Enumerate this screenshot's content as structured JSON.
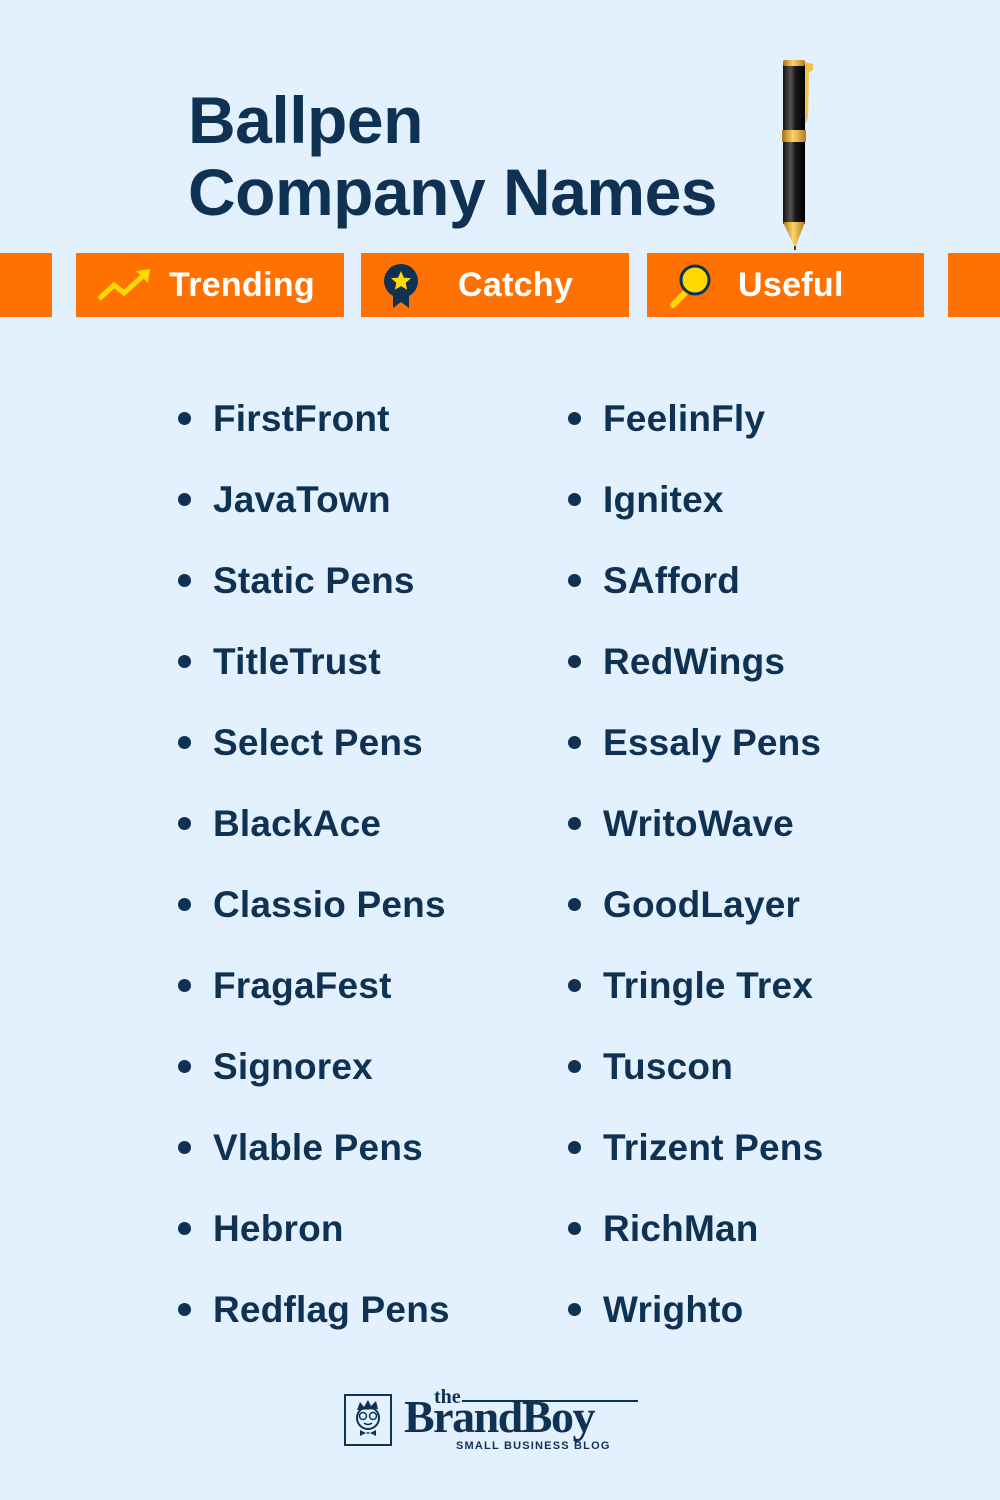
{
  "header": {
    "title_line1": "Ballpen",
    "title_line2": "Company Names",
    "pen_icon": "ballpoint-pen-icon"
  },
  "tags": [
    {
      "label": "Trending",
      "icon": "trending-up-arrow-icon"
    },
    {
      "label": "Catchy",
      "icon": "award-ribbon-star-icon"
    },
    {
      "label": "Useful",
      "icon": "magnifying-glass-icon"
    }
  ],
  "colors": {
    "background": "#e3f0fe",
    "accent_orange": "#ff7100",
    "text_navy": "#0f3253",
    "icon_yellow": "#ffd900"
  },
  "names_left": [
    "FirstFront",
    "JavaTown",
    "Static Pens",
    "TitleTrust",
    "Select Pens",
    "BlackAce",
    "Classio Pens",
    "FragaFest",
    "Signorex",
    "Vlable Pens",
    "Hebron",
    "Redflag Pens"
  ],
  "names_right": [
    "FeelinFly",
    "Ignitex",
    "SAfford",
    "RedWings",
    "Essaly Pens",
    "WritoWave",
    "GoodLayer",
    "Tringle Trex",
    "Tuscon",
    "Trizent Pens",
    "RichMan",
    "Wrighto"
  ],
  "footer": {
    "logo_the": "the",
    "logo_brand": "BrandBoy",
    "logo_tagline": "SMALL BUSINESS BLOG",
    "logo_icon": "brandboy-mascot-icon"
  }
}
